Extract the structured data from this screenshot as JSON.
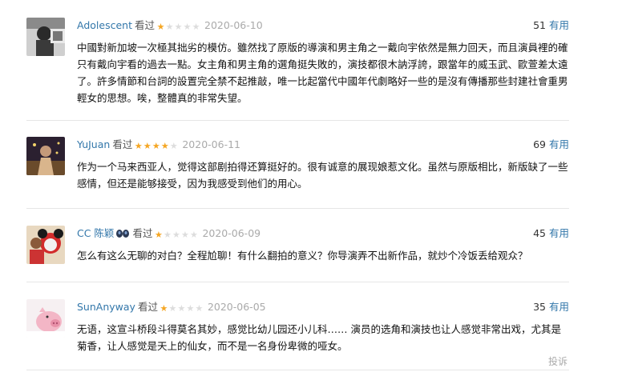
{
  "reviews": [
    {
      "author": "Adolescent",
      "seen_label": "看过",
      "rating": 1,
      "date": "2020-06-10",
      "useful_count": "51",
      "useful_label": "有用",
      "text": "中國對新加坡一次極其拙劣的模仿。雖然找了原版的導演和男主角之一戴向宇依然是無力回天，而且演員裡的確只有戴向宇看的過去一點。女主角和男主角的選角挺失敗的，演技都很木訥浮誇，跟當年的威玉武、歐萱差太遠了。許多情節和台詞的設置完全禁不起推敲，唯一比起當代中國年代劇略好一些的是沒有傳播那些封建社會重男輕女的思想。唉，整體真的非常失望。"
    },
    {
      "author": "YuJuan",
      "seen_label": "看过",
      "rating": 4,
      "date": "2020-06-11",
      "useful_count": "69",
      "useful_label": "有用",
      "text": "作为一个马来西亚人，觉得这部剧拍得还算挺好的。很有诚意的展现娘惹文化。虽然与原版相比，新版缺了一些感情，但还是能够接受，因为我感受到他们的用心。"
    },
    {
      "author": "CC 陈颖",
      "seen_label": "看过",
      "rating": 1,
      "date": "2020-06-09",
      "useful_count": "45",
      "useful_label": "有用",
      "text": "怎么有这么无聊的对白？全程尬聊！有什么翻拍的意义？你导演弄不出新作品，就炒个冷饭丢给观众？"
    },
    {
      "author": "SunAnyway",
      "seen_label": "看过",
      "rating": 1,
      "date": "2020-06-05",
      "useful_count": "35",
      "useful_label": "有用",
      "text": "无语，这宣斗桥段斗得莫名其妙，感觉比幼儿园还小儿科…… 演员的选角和演技也让人感觉非常出戏，尤其是菊香，让人感觉是天上的仙女，而不是一名身份卑微的哑女。"
    }
  ],
  "report_label": "投诉",
  "colors": {
    "link": "#3377aa",
    "star_on": "#f5a623",
    "star_off": "#dddddd",
    "date": "#aaaaaa",
    "divider": "#e6e6e6"
  }
}
